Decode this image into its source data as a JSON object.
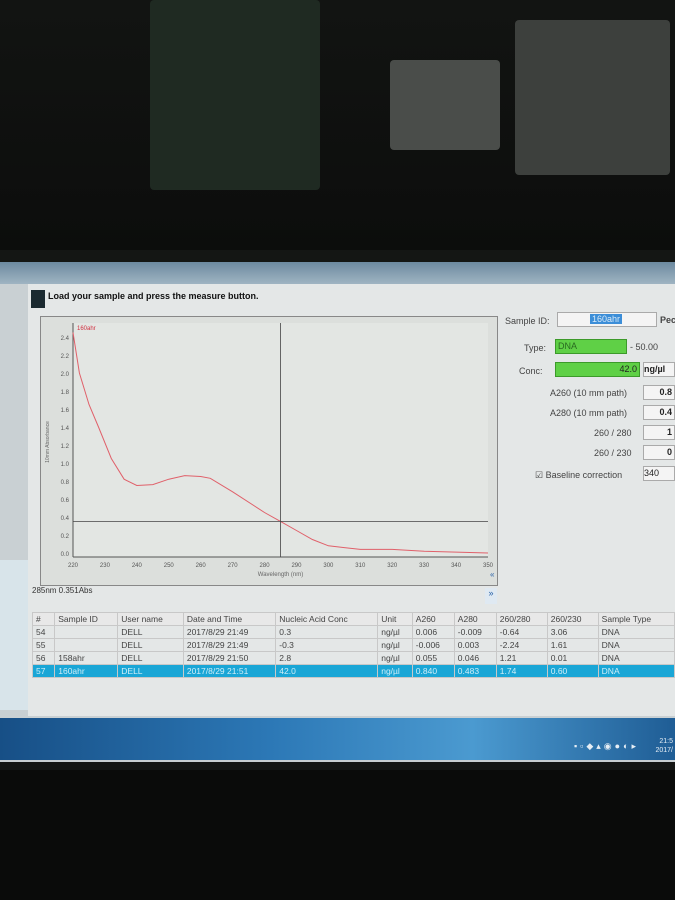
{
  "header": {
    "message": "Load your sample and press the measure button."
  },
  "chart": {
    "legend": "160ahr",
    "ylabel": "10mm Absorbance",
    "xlabel": "Wavelength (nm)",
    "cursor_readout": "285nm 0.351Abs",
    "collapse_icon": "chevron-double-left-icon",
    "expand_icon": "chevron-double-down-icon"
  },
  "chart_data": {
    "type": "line",
    "series": [
      {
        "name": "160ahr",
        "color": "#e0606a",
        "x": [
          220,
          222,
          225,
          228,
          232,
          236,
          240,
          245,
          250,
          255,
          260,
          263,
          270,
          280,
          285,
          290,
          295,
          300,
          305,
          310,
          320,
          330,
          340,
          350
        ],
        "y": [
          2.45,
          2.0,
          1.65,
          1.4,
          1.05,
          0.82,
          0.75,
          0.76,
          0.82,
          0.86,
          0.85,
          0.83,
          0.68,
          0.45,
          0.351,
          0.25,
          0.15,
          0.08,
          0.06,
          0.04,
          0.04,
          0.02,
          0.01,
          0.0
        ]
      }
    ],
    "xlim": [
      220,
      350
    ],
    "ylim": [
      0,
      2.4
    ],
    "xticks": [
      "220",
      "230",
      "240",
      "250",
      "260",
      "270",
      "280",
      "290",
      "300",
      "310",
      "320",
      "330",
      "340",
      "350"
    ],
    "yticks": [
      "0.0",
      "0.2",
      "0.4",
      "0.6",
      "0.8",
      "1.0",
      "1.2",
      "1.4",
      "1.6",
      "1.8",
      "2.0",
      "2.2",
      "2.4"
    ],
    "xlabel": "Wavelength (nm)",
    "ylabel": "10mm Absorbance",
    "cursor": {
      "x": 285,
      "y": 0.351
    },
    "grid": false
  },
  "panel": {
    "sample_id_label": "Sample ID:",
    "sample_id": "160ahr",
    "pec_label": "Pec",
    "type_label": "Type:",
    "type_value": "DNA",
    "factor": "- 50.00",
    "conc_label": "Conc:",
    "conc_value": "42.0",
    "conc_unit": "ng/µl",
    "a260_label": "A260 (10 mm path)",
    "a260_value": "0.8",
    "a280_label": "A280 (10 mm path)",
    "a280_value": "0.4",
    "r260_280_label": "260 / 280",
    "r260_280_value": "1",
    "r260_230_label": "260 / 230",
    "r260_230_value": "0",
    "baseline_label": "Baseline correction",
    "baseline_checked": true,
    "baseline_value": "340",
    "accent": "#5fd046"
  },
  "table": {
    "headers": [
      "#",
      "Sample ID",
      "User name",
      "Date and Time",
      "Nucleic Acid Conc",
      "Unit",
      "A260",
      "A280",
      "260/280",
      "260/230",
      "Sample Type"
    ],
    "rows": [
      [
        "54",
        "",
        "DELL",
        "2017/8/29 21:49",
        "0.3",
        "ng/µl",
        "0.006",
        "-0.009",
        "-0.64",
        "3.06",
        "DNA"
      ],
      [
        "55",
        "",
        "DELL",
        "2017/8/29 21:49",
        "-0.3",
        "ng/µl",
        "-0.006",
        "0.003",
        "-2.24",
        "1.61",
        "DNA"
      ],
      [
        "56",
        "158ahr",
        "DELL",
        "2017/8/29 21:50",
        "2.8",
        "ng/µl",
        "0.055",
        "0.046",
        "1.21",
        "0.01",
        "DNA"
      ],
      [
        "57",
        "160ahr",
        "DELL",
        "2017/8/29 21:51",
        "42.0",
        "ng/µl",
        "0.840",
        "0.483",
        "1.74",
        "0.60",
        "DNA"
      ]
    ],
    "selected_index": 3,
    "selection_color": "#1aa6d6"
  },
  "taskbar": {
    "clock_time": "21:5",
    "clock_date": "2017/"
  }
}
